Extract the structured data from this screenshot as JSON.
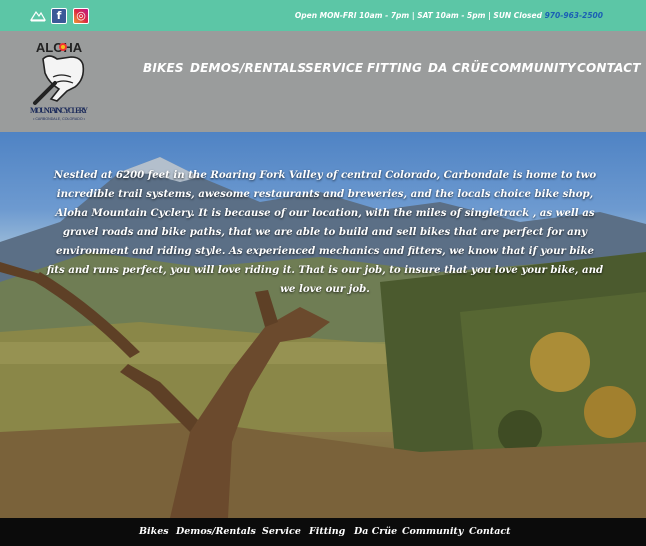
{
  "topbar": {
    "hours_text": "Open MON-FRI 10am - 7pm | SAT 10am - 5pm | SUN Closed",
    "phone": "970-963-2500",
    "facebook_glyph": "f",
    "instagram_glyph": "◎",
    "small_logo_icon": "mountain-icon",
    "color": "#5cc6a6"
  },
  "logo": {
    "brand_top": "ALOHA",
    "brand_name": "MOUNTAIN CYCLERY",
    "brand_location": "• CARBONDALE, COLORADO •"
  },
  "nav": {
    "items": [
      {
        "label": "BIKES"
      },
      {
        "label": "DEMOS/RENTALS"
      },
      {
        "label": "SERVICE"
      },
      {
        "label": "FITTING"
      },
      {
        "label": "DA CRÜE"
      },
      {
        "label": "COMMUNITY"
      },
      {
        "label": "CONTACT"
      }
    ]
  },
  "hero": {
    "intro": "Nestled at 6200 feet in the Roaring Fork Valley of central Colorado, Carbondale is home to two incredible trail systems, awesome restaurants and breweries, and the locals choice bike shop, Aloha Mountain Cyclery.  It is because of our location, with the miles of singletrack , as well as gravel roads and bike paths, that we are able to build and sell bikes that are perfect for any environment and riding style.  As experienced mechanics and fitters, we know that if your bike fits and runs perfect, you will love riding it. That is our job, to insure that you love your bike, and we love our job."
  },
  "footer": {
    "items": [
      {
        "label": "Bikes"
      },
      {
        "label": "Demos/Rentals"
      },
      {
        "label": "Service"
      },
      {
        "label": "Fitting"
      },
      {
        "label": "Da Crüe"
      },
      {
        "label": "Community"
      },
      {
        "label": "Contact"
      }
    ]
  }
}
